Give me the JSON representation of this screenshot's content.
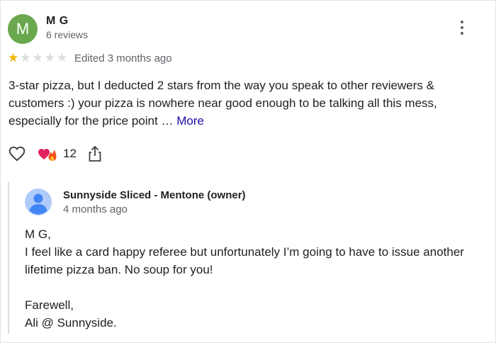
{
  "review": {
    "author_initial": "M",
    "author_name": "M G",
    "reviews_count": "6 reviews",
    "avatar_color": "#6aa84f",
    "rating": 1,
    "max_rating": 5,
    "edited_label": "Edited 3 months ago",
    "text": "3-star pizza, but I deducted 2 stars from the way you speak to other reviewers & customers :) your pizza is nowhere near good enough to be talking all this mess, especially for the price point …",
    "more_label": "More",
    "reaction_count": "12"
  },
  "reply": {
    "owner_name": "Sunnyside Sliced - Mentone (owner)",
    "time": "4 months ago",
    "lines": [
      "M G,",
      "I feel like a card happy referee but unfortunately I’m going to have to issue another lifetime pizza ban. No soup for you!",
      "",
      "Farewell,",
      "Ali @ Sunnyside."
    ]
  },
  "icons": {
    "heart": "heart-icon",
    "reactions": "heart-fire-reaction-icon",
    "share": "share-icon",
    "menu": "more-vert-icon",
    "owner_avatar": "person-avatar-icon"
  },
  "colors": {
    "star_filled": "#f4b400",
    "star_empty": "#dadce0",
    "link": "#1a0dab",
    "owner_avatar_bg": "#aecbfa",
    "owner_avatar_fg": "#4285f4"
  }
}
